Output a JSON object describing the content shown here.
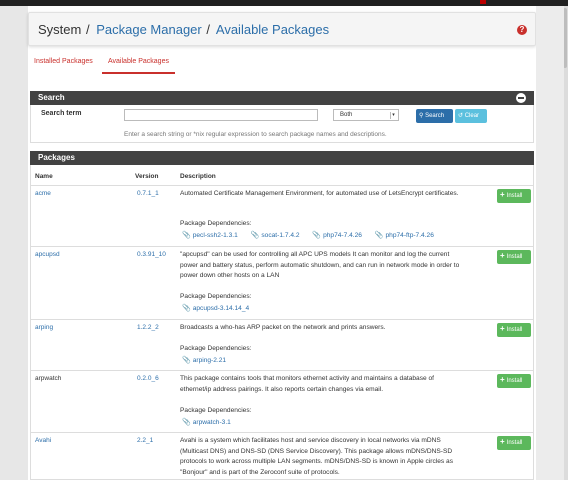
{
  "breadcrumb": {
    "root": "System",
    "sep1": "/",
    "mid": "Package Manager",
    "sep2": "/",
    "current": "Available Packages"
  },
  "help_icon": "?",
  "tabs": [
    {
      "label": "Installed Packages",
      "active": false
    },
    {
      "label": "Available Packages",
      "active": true
    }
  ],
  "search": {
    "panel_title": "Search",
    "term_label": "Search term",
    "term_value": "",
    "scope_selected": "Both",
    "search_button": "Search",
    "clear_button": "Clear",
    "hint": "Enter a search string or *nix regular expression to search package names and descriptions."
  },
  "packages": {
    "panel_title": "Packages",
    "columns": {
      "name": "Name",
      "version": "Version",
      "description": "Description"
    },
    "deps_label": "Package Dependencies:",
    "install_label": "Install",
    "rows": [
      {
        "name": "acme",
        "version": "0.7.1_1",
        "description": "Automated Certificate Management Environment, for automated use of LetsEncrypt certificates.",
        "deps": [
          "pecl-ssh2-1.3.1",
          "socat-1.7.4.2",
          "php74-7.4.26",
          "php74-ftp-7.4.26"
        ]
      },
      {
        "name": "apcupsd",
        "version": "0.3.91_10",
        "description": "\"apcupsd\" can be used for controlling all APC UPS models It can monitor and log the current power and battery status, perform automatic shutdown, and can run in network mode in order to power down other hosts on a LAN",
        "deps": [
          "apcupsd-3.14.14_4"
        ]
      },
      {
        "name": "arping",
        "version": "1.2.2_2",
        "description": "Broadcasts a who-has ARP packet on the network and prints answers.",
        "deps": [
          "arping-2.21"
        ]
      },
      {
        "name": "arpwatch",
        "version": "0.2.0_6",
        "description": "This package contains tools that monitors ethernet activity and maintains a database of ethernet/ip address pairings. It also reports certain changes via email.",
        "deps": [
          "arpwatch-3.1"
        ]
      },
      {
        "name": "Avahi",
        "version": "2.2_1",
        "description": "Avahi is a system which facilitates host and service discovery in local networks via mDNS (Multicast DNS) and DNS-SD (DNS Service Discovery). This package allows mDNS/DNS-SD protocols to work across multiple LAN segments. mDNS/DNS-SD is known in Apple circles as \"Bonjour\" and is part of the Zeroconf suite of protocols.",
        "deps": []
      }
    ]
  },
  "colors": {
    "link": "#2c6ea9",
    "tab_active": "#c9302c",
    "panel_head": "#424242",
    "install": "#5cb85c",
    "search_btn": "#2c6ea9",
    "clear_btn": "#5bc0de"
  }
}
